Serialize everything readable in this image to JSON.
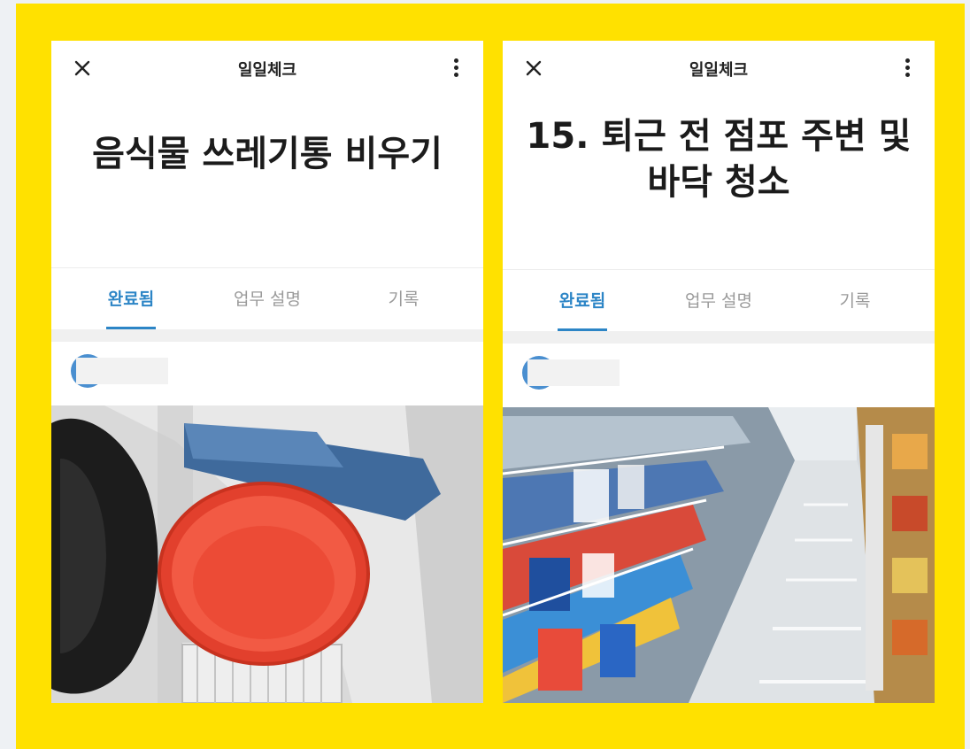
{
  "screens": [
    {
      "appbar": {
        "title": "일일체크",
        "close_icon": "close-icon",
        "menu_icon": "more-vertical-icon"
      },
      "task_title": "음식물 쓰레기통 비우기",
      "tabs": [
        {
          "label": "완료됨",
          "active": true
        },
        {
          "label": "업무 설명"
        },
        {
          "label": "기록"
        }
      ],
      "photo_icon": "photo-food-waste-bin"
    },
    {
      "appbar": {
        "title": "일일체크",
        "close_icon": "close-icon",
        "menu_icon": "more-vertical-icon"
      },
      "task_title": "15. 퇴근 전 점포 주변 및 바닥 청소",
      "tabs": [
        {
          "label": "완료됨",
          "active": true
        },
        {
          "label": "업무 설명"
        },
        {
          "label": "기록"
        }
      ],
      "photo_icon": "photo-store-aisle"
    }
  ],
  "colors": {
    "frame": "#ffe100",
    "accent": "#2c85c6",
    "avatar": "#4a8fd0"
  }
}
